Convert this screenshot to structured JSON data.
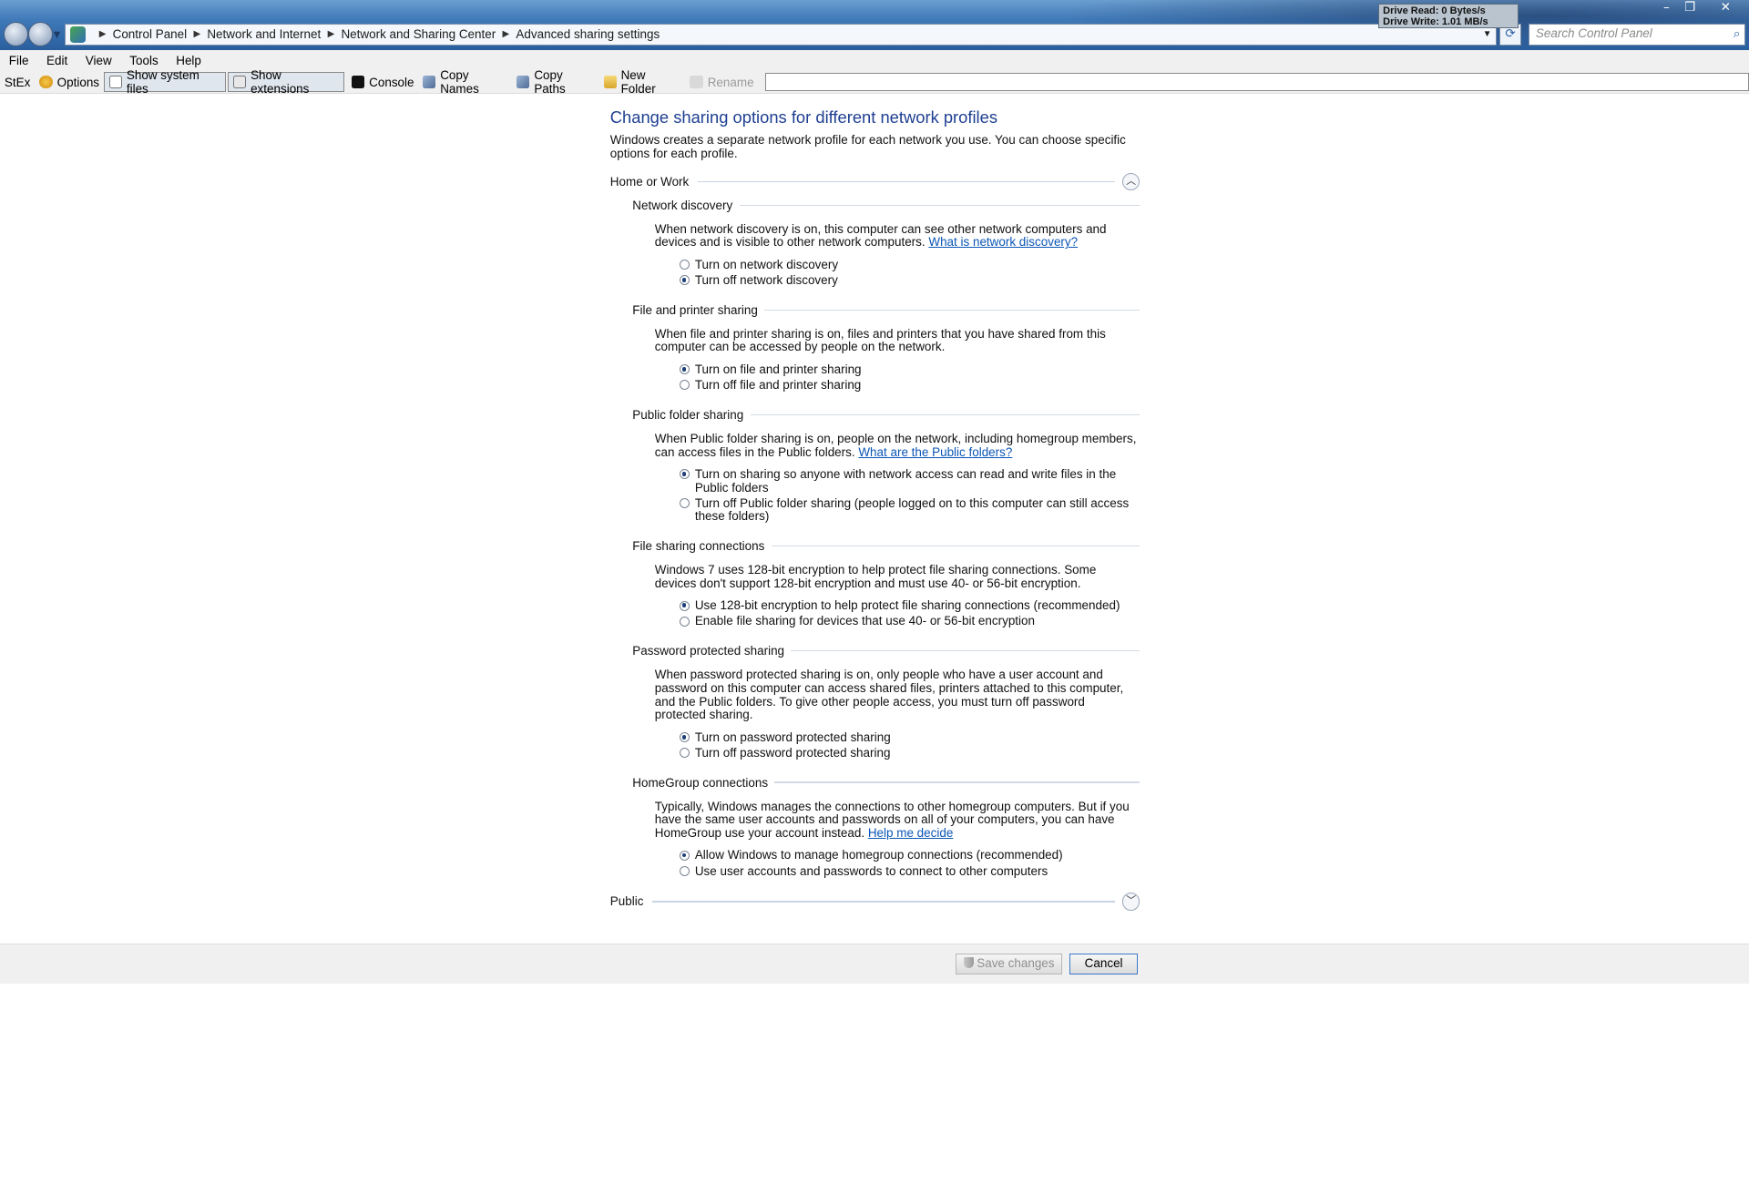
{
  "address": {
    "crumbs": [
      "Control Panel",
      "Network and Internet",
      "Network and Sharing Center",
      "Advanced sharing settings"
    ]
  },
  "search": {
    "placeholder": "Search Control Panel"
  },
  "drive_monitor": {
    "read": "Drive Read:  0 Bytes/s",
    "write": "Drive Write: 1.01 MB/s"
  },
  "menu": [
    "File",
    "Edit",
    "View",
    "Tools",
    "Help"
  ],
  "toolbar": {
    "stex": "StEx",
    "options": "Options",
    "show_system_files": "Show system files",
    "show_extensions": "Show extensions",
    "console": "Console",
    "copy_names": "Copy Names",
    "copy_paths": "Copy Paths",
    "new_folder": "New Folder",
    "rename": "Rename"
  },
  "page": {
    "heading": "Change sharing options for different network profiles",
    "intro": "Windows creates a separate network profile for each network you use. You can choose specific options for each profile.",
    "profile_home": "Home or Work",
    "profile_public": "Public"
  },
  "sections": [
    {
      "title": "Network discovery",
      "desc": "When network discovery is on, this computer can see other network computers and devices and is visible to other network computers.",
      "link": "What is network discovery?",
      "options": [
        {
          "label": "Turn on network discovery",
          "selected": false
        },
        {
          "label": "Turn off network discovery",
          "selected": true
        }
      ]
    },
    {
      "title": "File and printer sharing",
      "desc": "When file and printer sharing is on, files and printers that you have shared from this computer can be accessed by people on the network.",
      "link": "",
      "options": [
        {
          "label": "Turn on file and printer sharing",
          "selected": true
        },
        {
          "label": "Turn off file and printer sharing",
          "selected": false
        }
      ]
    },
    {
      "title": "Public folder sharing",
      "desc": "When Public folder sharing is on, people on the network, including homegroup members, can access files in the Public folders.",
      "link": "What are the Public folders?",
      "options": [
        {
          "label": "Turn on sharing so anyone with network access can read and write files in the Public folders",
          "selected": true
        },
        {
          "label": "Turn off Public folder sharing (people logged on to this computer can still access these folders)",
          "selected": false
        }
      ]
    },
    {
      "title": "File sharing connections",
      "desc": "Windows 7 uses 128-bit encryption to help protect file sharing connections. Some devices don't support 128-bit encryption and must use 40- or 56-bit encryption.",
      "link": "",
      "options": [
        {
          "label": "Use 128-bit encryption to help protect file sharing connections (recommended)",
          "selected": true
        },
        {
          "label": "Enable file sharing for devices that use 40- or 56-bit encryption",
          "selected": false
        }
      ]
    },
    {
      "title": "Password protected sharing",
      "desc": "When password protected sharing is on, only people who have a user account and password on this computer can access shared files, printers attached to this computer, and the Public folders. To give other people access, you must turn off password protected sharing.",
      "link": "",
      "options": [
        {
          "label": "Turn on password protected sharing",
          "selected": true
        },
        {
          "label": "Turn off password protected sharing",
          "selected": false
        }
      ]
    },
    {
      "title": "HomeGroup connections",
      "desc": "Typically, Windows manages the connections to other homegroup computers. But if you have the same user accounts and passwords on all of your computers, you can have HomeGroup use your account instead.",
      "link": "Help me decide",
      "options": [
        {
          "label": "Allow Windows to manage homegroup connections (recommended)",
          "selected": true
        },
        {
          "label": "Use user accounts and passwords to connect to other computers",
          "selected": false
        }
      ]
    }
  ],
  "buttons": {
    "save": "Save changes",
    "cancel": "Cancel"
  },
  "window": {
    "min": "–",
    "max": "❐",
    "close": "✕"
  }
}
